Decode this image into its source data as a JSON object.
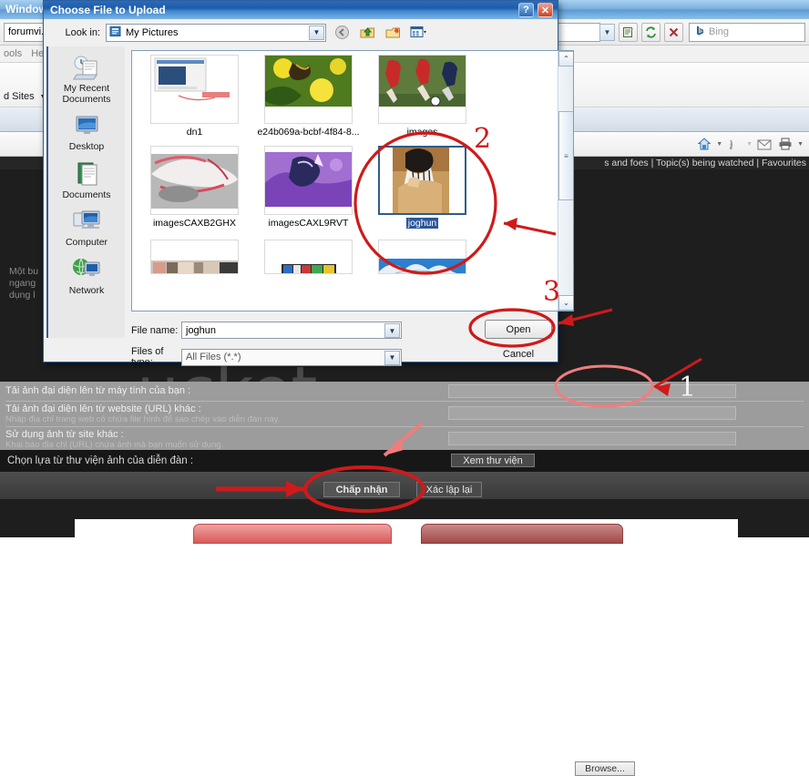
{
  "browser": {
    "window_title": "Window",
    "address_value": "forumvi.c",
    "menu_items": [
      "ools",
      "Help"
    ],
    "favbar_label": "d Sites",
    "search_placeholder": "Bing",
    "toolbar_icons": [
      "compat-view-icon",
      "refresh-icon",
      "stop-icon"
    ],
    "command_icons": [
      "home-icon",
      "feeds-icon",
      "mail-icon",
      "print-icon"
    ],
    "forum_nav": "s and foes  |  Topic(s) being watched  |  Favourites",
    "forum_text": "Một bu\nngang\ndụng l",
    "watermark": "ucket"
  },
  "upload_form": {
    "rows": [
      {
        "label": "Tải ảnh đại diện lên từ máy tính của bạn :",
        "sub": ""
      },
      {
        "label": "Tải ảnh đại diện lên từ website (URL) khác :",
        "sub": "Nhập địa chỉ trang web có chứa file hình để sao chép vào diễn đàn này."
      },
      {
        "label": "Sử dụng ảnh từ site khác :",
        "sub": "Khai báo địa chỉ (URL) chứa ảnh mà bạn muốn sử dụng."
      }
    ],
    "browse_label": "Browse...",
    "gallery_label": "Chọn lựa từ thư viện ảnh của diễn đàn :",
    "view_gallery_label": "Xem thư viện",
    "accept_label": "Chấp nhận",
    "reset_label": "Xác lập lại"
  },
  "dialog": {
    "title": "Choose File to Upload",
    "help_label": "?",
    "close_label": "✕",
    "lookin_label": "Look in:",
    "lookin_value": "My Pictures",
    "toolbar_icons": [
      "back-icon",
      "up-one-level-icon",
      "new-folder-icon",
      "views-icon"
    ],
    "places": [
      {
        "label": "My Recent Documents",
        "icon": "recent-documents-icon"
      },
      {
        "label": "Desktop",
        "icon": "desktop-icon"
      },
      {
        "label": "Documents",
        "icon": "documents-icon"
      },
      {
        "label": "Computer",
        "icon": "computer-icon"
      },
      {
        "label": "Network",
        "icon": "network-icon"
      }
    ],
    "files": [
      {
        "name": "dn1",
        "selected": false,
        "kind": "screenshot"
      },
      {
        "name": "e24b069a-bcbf-4f84-8...",
        "selected": false,
        "kind": "butterfly"
      },
      {
        "name": "images",
        "selected": false,
        "kind": "soccer"
      },
      {
        "name": "imagesCAXB2GHX",
        "selected": false,
        "kind": "car"
      },
      {
        "name": "imagesCAXL9RVT",
        "selected": false,
        "kind": "fantasy"
      },
      {
        "name": "joghun",
        "selected": true,
        "kind": "portrait"
      },
      {
        "name": "",
        "selected": false,
        "kind": "crowd"
      },
      {
        "name": "",
        "selected": false,
        "kind": "banner"
      },
      {
        "name": "",
        "selected": false,
        "kind": "mountain"
      }
    ],
    "filename_label": "File name:",
    "filename_value": "joghun",
    "filetype_label": "Files of type:",
    "filetype_value": "All Files (*.*)",
    "open_label": "Open",
    "cancel_label": "Cancel",
    "scroll_up": "⌃",
    "scroll_down": "⌄"
  },
  "annotations": {
    "step1": "1",
    "step2": "2",
    "step3": "3",
    "accent_color": "#cf1a1a",
    "accent_light": "#f07d7d"
  }
}
